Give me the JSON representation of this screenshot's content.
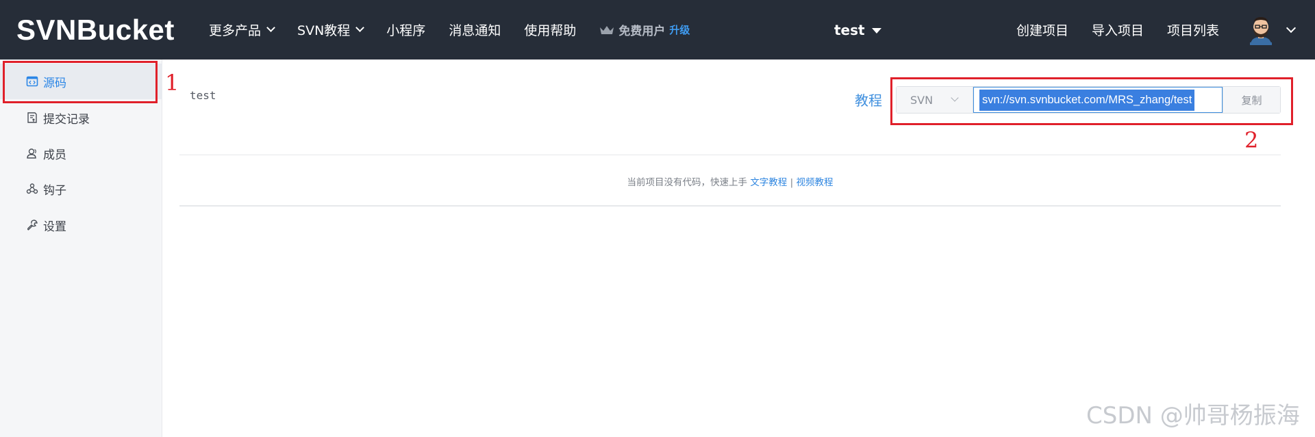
{
  "header": {
    "logo": "SVNBucket",
    "nav": {
      "more_products": "更多产品",
      "svn_tutorial": "SVN教程",
      "mini_program": "小程序",
      "notifications": "消息通知",
      "help": "使用帮助",
      "free_user": "免费用户",
      "upgrade": "升级"
    },
    "project": "test",
    "create_project": "创建项目",
    "import_project": "导入项目",
    "project_list": "项目列表"
  },
  "sidebar": {
    "items": [
      {
        "label": "源码",
        "icon": "code-icon",
        "active": true
      },
      {
        "label": "提交记录",
        "icon": "commit-log-icon",
        "active": false
      },
      {
        "label": "成员",
        "icon": "members-icon",
        "active": false
      },
      {
        "label": "钩子",
        "icon": "webhook-icon",
        "active": false
      },
      {
        "label": "设置",
        "icon": "settings-wrench-icon",
        "active": false
      }
    ]
  },
  "main": {
    "project_name": "test",
    "tutorial_link": "教程",
    "protocol": "SVN",
    "repo_url": "svn://svn.svnbucket.com/MRS_zhang/test",
    "copy_label": "复制",
    "empty_text": "当前项目没有代码，快速上手",
    "text_tutorial": "文字教程",
    "separator": "|",
    "video_tutorial": "视频教程"
  },
  "annotations": {
    "label_1": "1",
    "label_2": "2",
    "color": "#e0202a"
  },
  "watermark": "CSDN @帅哥杨振海",
  "colors": {
    "topbar": "#262d38",
    "accent": "#3f8fde",
    "sidebar": "#f5f6f8"
  }
}
